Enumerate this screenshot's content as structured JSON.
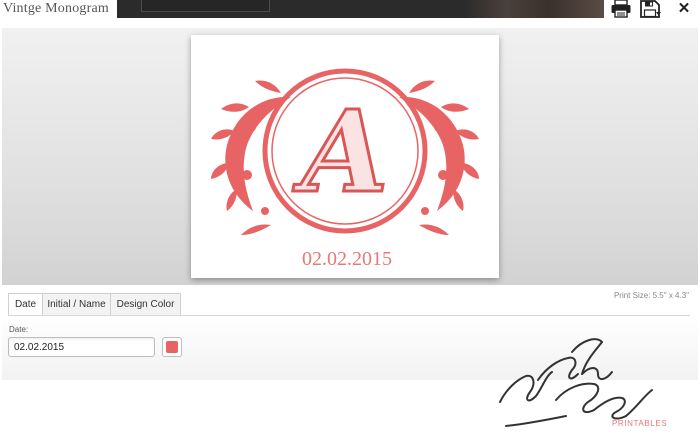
{
  "window": {
    "title": "Vintge Monogram"
  },
  "toolbar": {
    "print_icon": "printer-icon",
    "save_icon": "save-icon",
    "close_icon": "close-icon",
    "close_glyph": "✕"
  },
  "preview": {
    "initial": "A",
    "date_text": "02.02.2015",
    "print_size": "Print Size: 5.5\" x 4.3\""
  },
  "tabs": [
    {
      "label": "Date",
      "active": true
    },
    {
      "label": "Initial / Name",
      "active": false
    },
    {
      "label": "Design Color",
      "active": false
    }
  ],
  "date_panel": {
    "label": "Date:",
    "value": "02.02.2015"
  },
  "colors": {
    "design": "#e86464",
    "accent_text": "#e8787a"
  },
  "brand": {
    "logo_text": "Wedding Chicks",
    "printables": "PRINTABLES"
  }
}
